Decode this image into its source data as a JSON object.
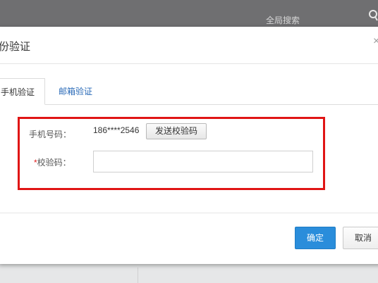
{
  "background": {
    "search_label": "全局搜索"
  },
  "dialog": {
    "title": "份验证",
    "close_glyph": "×",
    "tabs": [
      {
        "label": "手机验证",
        "active": true
      },
      {
        "label": "邮箱验证",
        "active": false
      }
    ],
    "phone": {
      "label": "手机号码：",
      "value": "186****2546",
      "send_button": "发送校验码"
    },
    "code": {
      "required_mark": "*",
      "label": "校验码：",
      "value": "",
      "placeholder": ""
    },
    "buttons": {
      "ok": "确定",
      "cancel": "取消"
    }
  },
  "colors": {
    "primary": "#2a8ddb",
    "highlight": "#e01515",
    "link": "#2b6bb8"
  },
  "icons": {
    "search": "search-icon",
    "close": "close-icon"
  }
}
